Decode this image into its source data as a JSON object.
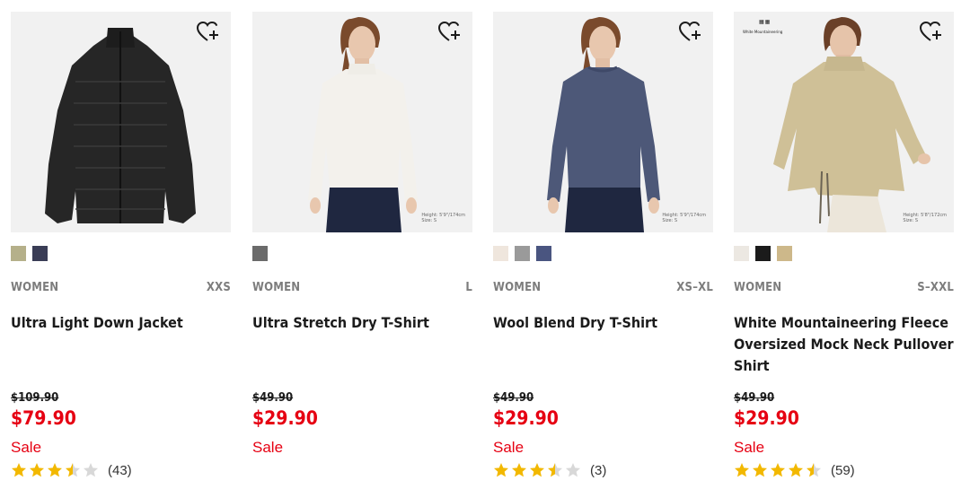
{
  "colors": {
    "sale_red": "#e60012",
    "star_gold": "#f2b800",
    "star_empty": "#d8d8d8",
    "meta_gray": "#7d7d7d"
  },
  "products": [
    {
      "image_desc": "black puffer jacket",
      "heart_icon": "heart-plus-icon",
      "swatches": [
        "#b5b08a",
        "#3a3d56"
      ],
      "gender": "WOMEN",
      "size": "XXS",
      "name": "Ultra Light Down Jacket",
      "old_price": "$109.90",
      "price": "$79.90",
      "sale_label": "Sale",
      "rating": 3.5,
      "review_count": "(43)"
    },
    {
      "image_desc": "model in white mock neck top",
      "heart_icon": "heart-plus-icon",
      "model_note": [
        "Height: 5'9\"/174cm",
        "Size: S"
      ],
      "swatches": [
        "#6b6b6b"
      ],
      "gender": "WOMEN",
      "size": "L",
      "name": "Ultra Stretch Dry T-Shirt",
      "old_price": "$49.90",
      "price": "$29.90",
      "sale_label": "Sale"
    },
    {
      "image_desc": "model in navy long sleeve top",
      "heart_icon": "heart-plus-icon",
      "model_note": [
        "Height: 5'9\"/174cm",
        "Size: S"
      ],
      "swatches": [
        "#efe6dd",
        "#9a9a9a",
        "#4a5580"
      ],
      "gender": "WOMEN",
      "size": "XS–XL",
      "name": "Wool Blend Dry T-Shirt",
      "old_price": "$49.90",
      "price": "$29.90",
      "sale_label": "Sale",
      "rating": 3.5,
      "review_count": "(3)"
    },
    {
      "image_desc": "model in beige fleece pullover",
      "heart_icon": "heart-plus-icon",
      "collab_logo": "White Mountaineering",
      "model_note": [
        "Height: 5'8\"/172cm",
        "Size: S"
      ],
      "swatches": [
        "#ece8e2",
        "#1b1b1b",
        "#cdb88a"
      ],
      "gender": "WOMEN",
      "size": "S–XXL",
      "name": "White Mountaineering Fleece Oversized Mock Neck Pullover Shirt",
      "old_price": "$49.90",
      "price": "$29.90",
      "sale_label": "Sale",
      "rating": 4.5,
      "review_count": "(59)"
    }
  ]
}
